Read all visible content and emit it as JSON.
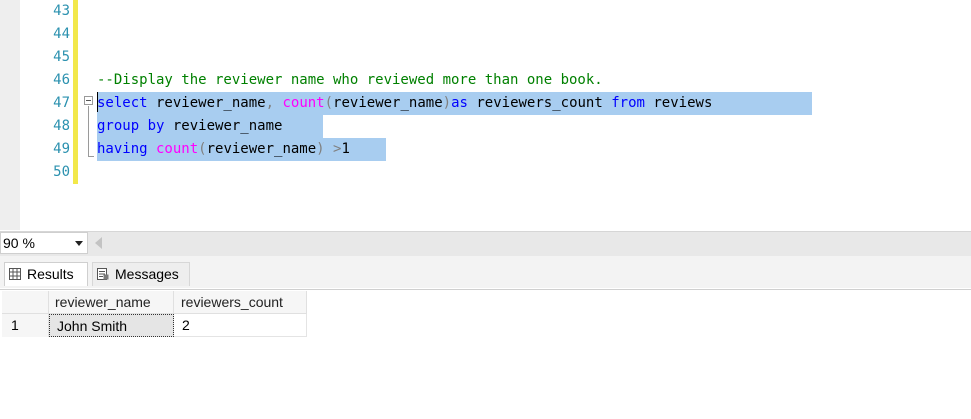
{
  "editor": {
    "line_numbers": [
      "43",
      "44",
      "45",
      "46",
      "47",
      "48",
      "49",
      "50"
    ],
    "comment": "--Display the reviewer name who reviewed more than one book.",
    "line47": {
      "kw_select": "select",
      "t_field": " reviewer_name",
      "t_comma": ",",
      "fn_count": " count",
      "t_paren_open": "(",
      "t_arg": "reviewer_name",
      "t_paren_close": ")",
      "kw_as": "as",
      "t_alias": " reviewers_count ",
      "kw_from": "from",
      "t_table": " reviews "
    },
    "line48": {
      "kw_group_by": "group by",
      "t_field": " reviewer_name "
    },
    "line49": {
      "kw_having": "having",
      "fn_count": " count",
      "t_paren_open": "(",
      "t_arg": "reviewer_name",
      "t_paren_close": ")",
      "t_gt": " >",
      "t_num": "1"
    }
  },
  "toolbar": {
    "zoom_value": "90 %"
  },
  "tabs": {
    "results_label": "Results",
    "messages_label": "Messages"
  },
  "grid": {
    "columns": [
      "reviewer_name",
      "reviewers_count"
    ],
    "rows": [
      {
        "row_num": "1",
        "reviewer_name": "John Smith",
        "reviewers_count": "2"
      }
    ]
  },
  "colors": {
    "selection": "#a8cdf0",
    "keyword": "#0000ff",
    "function": "#ff00ff",
    "comment": "#008000",
    "line_number": "#2b91af"
  },
  "icons": [
    "fold-minus-icon",
    "dropdown-arrow-icon",
    "scroll-left-arrow-icon",
    "grid-icon",
    "messages-icon"
  ]
}
